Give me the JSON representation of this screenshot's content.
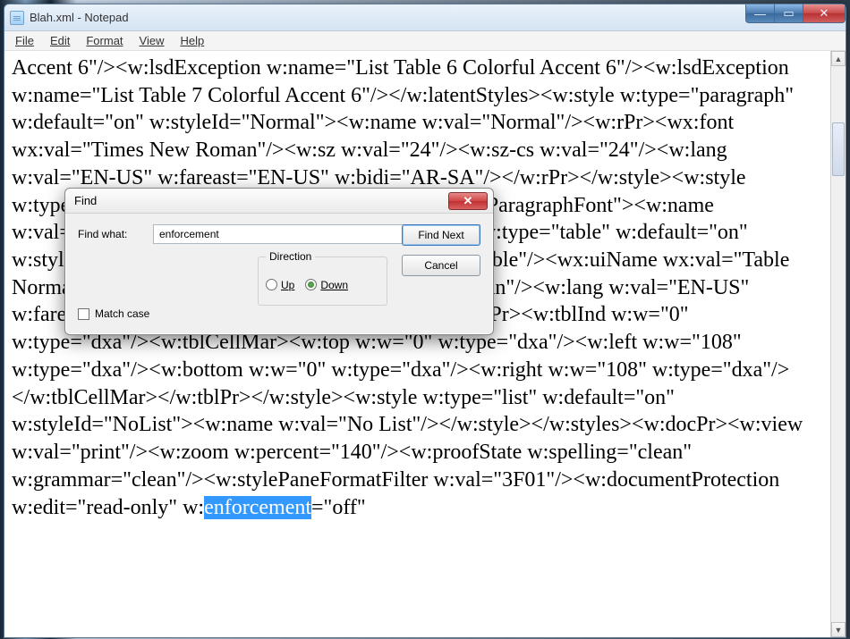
{
  "window": {
    "title": "Blah.xml - Notepad",
    "controls": {
      "min": "—",
      "max": "▭",
      "close": "✕"
    }
  },
  "menu": {
    "file": "File",
    "edit": "Edit",
    "format": "Format",
    "view": "View",
    "help": "Help"
  },
  "editor": {
    "pre": "Accent 6\"/><w:lsdException w:name=\"List Table 6 Colorful Accent 6\"/><w:lsdException w:name=\"List Table 7 Colorful Accent 6\"/></w:latentStyles><w:style w:type=\"paragraph\" w:default=\"on\" w:styleId=\"Normal\"><w:name w:val=\"Normal\"/><w:rPr><wx:font wx:val=\"Times New Roman\"/><w:sz w:val=\"24\"/><w:sz-cs w:val=\"24\"/><w:lang w:val=\"EN-US\" w:fareast=\"EN-US\" w:bidi=\"AR-SA\"/></w:rPr></w:style><w:style w:type=\"character\" w:default=\"on\" w:styleId=\"DefaultParagraphFont\"><w:name w:val=\"Default Paragraph Font\"/></w:style><w:style w:type=\"table\" w:default=\"on\" w:styleId=\"TableNormal\"><w:name w:val=\"Normal Table\"/><wx:uiName wx:val=\"Table Normal\"/><w:rPr><wx:font wx:val=\"Times New Roman\"/><w:lang w:val=\"EN-US\" w:fareast=\"EN-US\" w:bidi=\"AR-SA\"/></w:rPr><w:tblPr><w:tblInd w:w=\"0\" w:type=\"dxa\"/><w:tblCellMar><w:top w:w=\"0\" w:type=\"dxa\"/><w:left w:w=\"108\" w:type=\"dxa\"/><w:bottom w:w=\"0\" w:type=\"dxa\"/><w:right w:w=\"108\" w:type=\"dxa\"/></w:tblCellMar></w:tblPr></w:style><w:style w:type=\"list\" w:default=\"on\" w:styleId=\"NoList\"><w:name w:val=\"No List\"/></w:style></w:styles><w:docPr><w:view w:val=\"print\"/><w:zoom w:percent=\"140\"/><w:proofState w:spelling=\"clean\" w:grammar=\"clean\"/><w:stylePaneFormatFilter w:val=\"3F01\"/><w:documentProtection w:edit=\"read-only\" w:",
    "highlight": "enforcement",
    "post": "=\"off\""
  },
  "find": {
    "title": "Find",
    "label": "Find what:",
    "value": "enforcement",
    "find_next": "Find Next",
    "cancel": "Cancel",
    "direction_label": "Direction",
    "up": "Up",
    "down": "Down",
    "match_case": "Match case",
    "close": "✕"
  }
}
